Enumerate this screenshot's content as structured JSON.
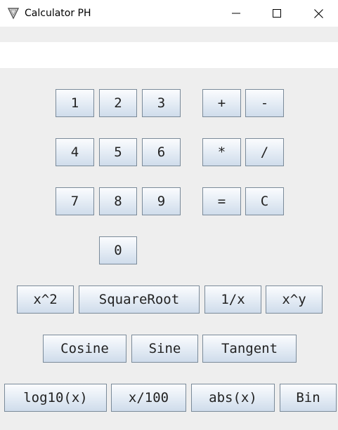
{
  "window": {
    "title": "Calculator PH",
    "controls": {
      "minimize": "minimize-icon",
      "maximize": "maximize-icon",
      "close": "close-icon"
    }
  },
  "display": {
    "value": "",
    "placeholder": ""
  },
  "keys": {
    "k1": "1",
    "k2": "2",
    "k3": "3",
    "k4": "4",
    "k5": "5",
    "k6": "6",
    "k7": "7",
    "k8": "8",
    "k9": "9",
    "k0": "0",
    "plus": "+",
    "minus": "-",
    "multiply": "*",
    "divide": "/",
    "equals": "=",
    "clear": "C"
  },
  "functions": {
    "square": "x^2",
    "sqrt": "SquareRoot",
    "reciprocal": "1/x",
    "power": "x^y",
    "cosine": "Cosine",
    "sine": "Sine",
    "tangent": "Tangent",
    "log10": "log10(x)",
    "percent": "x/100",
    "abs": "abs(x)",
    "bin": "Bin"
  },
  "colors": {
    "button_border": "#7a8a99",
    "window_bg": "#eeeeee",
    "titlebar_bg": "#ffffff"
  }
}
